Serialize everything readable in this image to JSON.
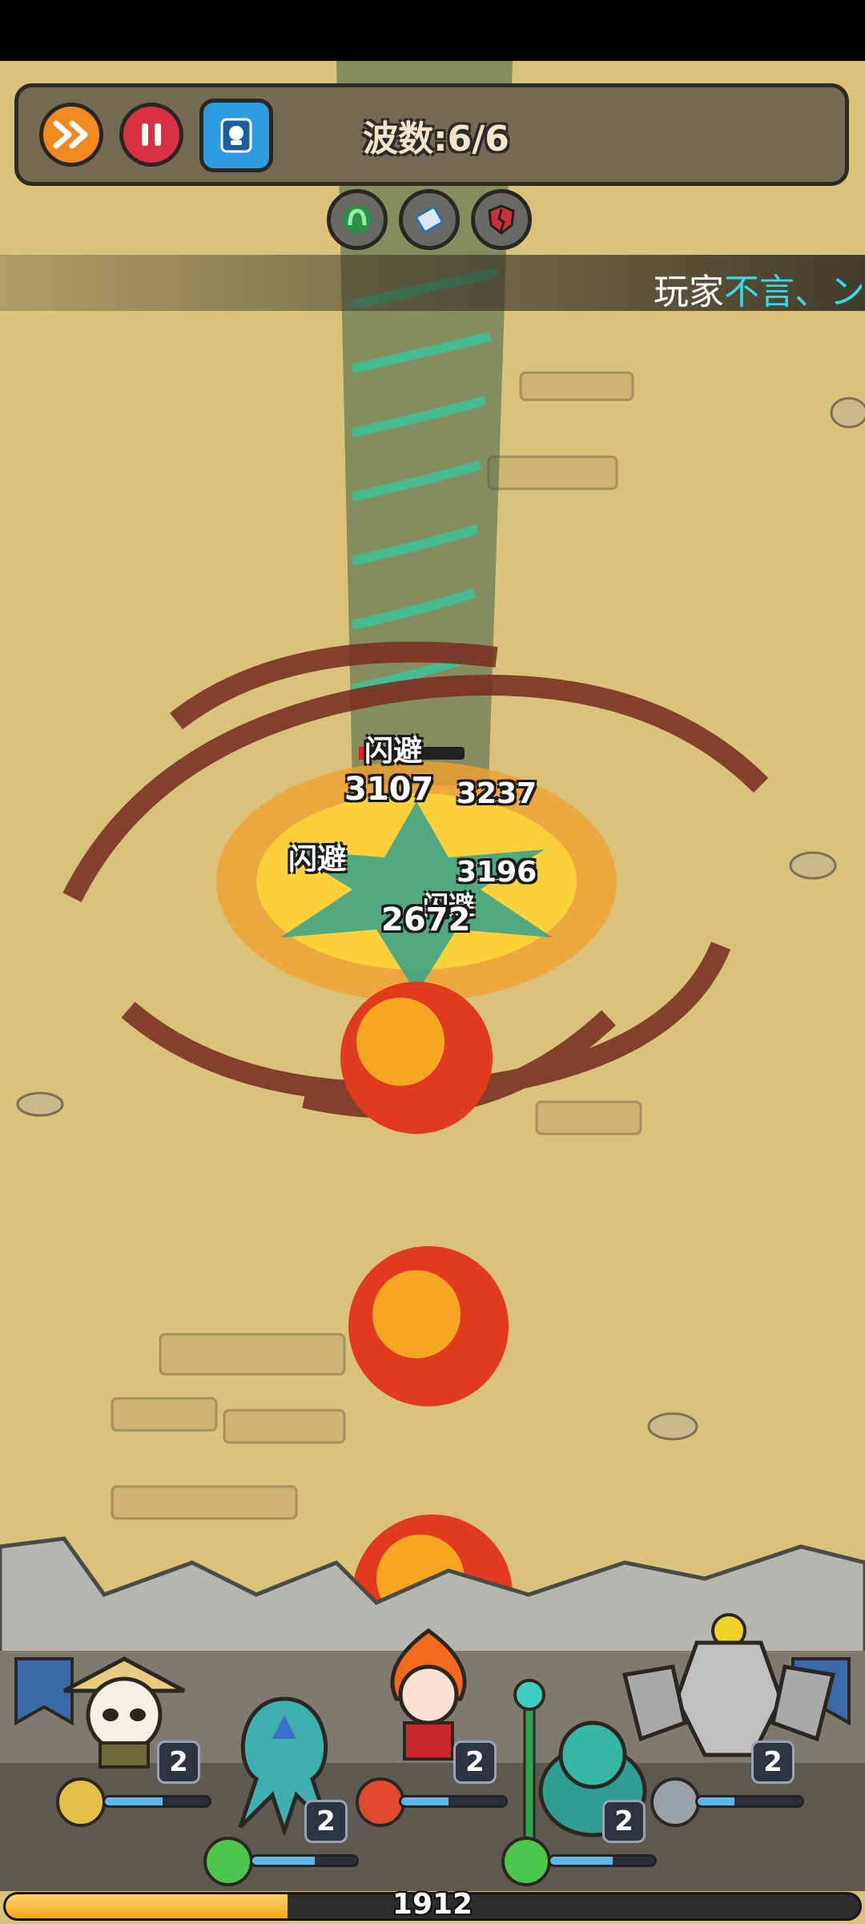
{
  "top_bar": {
    "speed_button_icon": "fast-forward-icon",
    "pause_button_icon": "pause-icon",
    "card_button_icon": "card-deck-icon",
    "wave_label": "波数:6/6"
  },
  "skills": [
    {
      "icon": "green-swirl-skill-icon"
    },
    {
      "icon": "scroll-skill-icon"
    },
    {
      "icon": "broken-shield-skill-icon"
    }
  ],
  "ticker": {
    "prefix": "玩家",
    "name": "不言、ン"
  },
  "damage_numbers": [
    "3107",
    "3237",
    "3196",
    "2672"
  ],
  "miss_texts": [
    "闪避",
    "闪避",
    "闪避",
    "闪避"
  ],
  "heroes": [
    {
      "name": "panda-monk",
      "level": "2",
      "hp": 0.55,
      "type_icon": "earth-type-icon",
      "type_color": "#e3c04a"
    },
    {
      "name": "water-squid",
      "level": "2",
      "hp": 0.6,
      "type_icon": "wind-type-icon",
      "type_color": "#4cc64a"
    },
    {
      "name": "fire-girl",
      "level": "2",
      "hp": 0.45,
      "type_icon": "fire-type-icon",
      "type_color": "#e04a2a"
    },
    {
      "name": "green-bird-mage",
      "level": "2",
      "hp": 0.6,
      "type_icon": "wind-type-icon",
      "type_color": "#4cc64a"
    },
    {
      "name": "stone-golem",
      "level": "2",
      "hp": 0.35,
      "type_icon": "rock-type-icon",
      "type_color": "#9aa0a8"
    }
  ],
  "progress": {
    "value": "1912",
    "fill": 0.33
  },
  "colors": {
    "accent_orange": "#f08a1e",
    "pause_red": "#d93043",
    "hp_blue": "#5fb8e8",
    "player_name": "#38d8e6"
  }
}
